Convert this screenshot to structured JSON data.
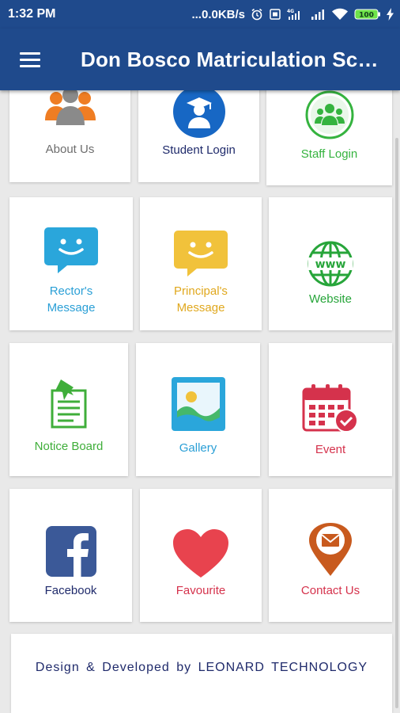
{
  "status_bar": {
    "time": "1:32 PM",
    "network_speed": "...0.0KB/s",
    "battery": "100",
    "icons": [
      "alarm-icon",
      "sim-icon",
      "signal-icon",
      "wifi-icon",
      "battery-icon",
      "charging-icon"
    ]
  },
  "app_bar": {
    "menu_icon": "hamburger-menu-icon",
    "title": "Don Bosco Matriculation Sch…",
    "background": "#1f4a8c"
  },
  "tiles": [
    {
      "label": "About Us",
      "icon": "people-group-icon",
      "color": "#6d6d6d"
    },
    {
      "label": "Student Login",
      "icon": "graduate-student-icon",
      "color": "#1f2a6b"
    },
    {
      "label": "Staff Login",
      "icon": "staff-group-icon",
      "color": "#35b33f"
    },
    {
      "label": "Rector's\nMessage",
      "icon": "chat-bubble-icon",
      "color": "#2a9fd6"
    },
    {
      "label": "Principal's\nMessage",
      "icon": "chat-bubble-icon",
      "color": "#e0a81e"
    },
    {
      "label": "Website",
      "icon": "www-globe-icon",
      "color": "#27a53a"
    },
    {
      "label": "Notice Board",
      "icon": "notice-clipboard-icon",
      "color": "#3fae3a"
    },
    {
      "label": "Gallery",
      "icon": "picture-icon",
      "color": "#2a9fd6"
    },
    {
      "label": "Event",
      "icon": "calendar-check-icon",
      "color": "#d5324c"
    },
    {
      "label": "Facebook",
      "icon": "facebook-icon",
      "color": "#1f2a6b"
    },
    {
      "label": "Favourite",
      "icon": "heart-icon",
      "color": "#d5324c"
    },
    {
      "label": "Contact Us",
      "icon": "mail-location-pin-icon",
      "color": "#d5324c"
    }
  ],
  "footer": {
    "text": "Design & Developed by LEONARD TECHNOLOGY"
  }
}
